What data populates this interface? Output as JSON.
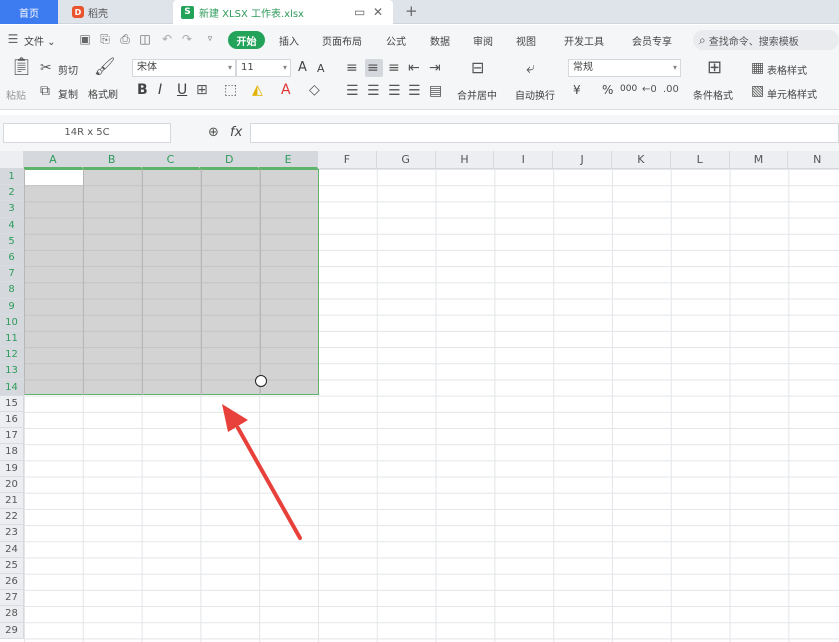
{
  "tabs": {
    "home": "首页",
    "daoke": "稻壳",
    "file": "新建 XLSX 工作表.xlsx",
    "new_tab": "+",
    "close": "✕"
  },
  "menu": {
    "file": "文件",
    "start": "开始",
    "items": [
      "插入",
      "页面布局",
      "公式",
      "数据",
      "审阅",
      "视图",
      "开发工具",
      "会员专享"
    ],
    "search_placeholder": "查找命令、搜索模板"
  },
  "ribbon": {
    "paste": "粘贴",
    "cut": "剪切",
    "copy": "复制",
    "format_painter": "格式刷",
    "font_name": "宋体",
    "font_size": "11",
    "bold": "B",
    "italic": "I",
    "underline": "U",
    "merge_center": "合并居中",
    "wrap_text": "自动换行",
    "number_format": "常规",
    "currency": "¥",
    "percent": "%",
    "thousands": "000",
    "cond_format": "条件格式",
    "table_style": "表格样式",
    "cell_style": "单元格样式",
    "font_grow": "A",
    "font_shrink": "A"
  },
  "formula_bar": {
    "name_box": "14R x 5C",
    "fx": "fx"
  },
  "grid": {
    "columns": [
      "A",
      "B",
      "C",
      "D",
      "E",
      "F",
      "G",
      "H",
      "I",
      "J",
      "K",
      "L",
      "M",
      "N"
    ],
    "rows": [
      "1",
      "2",
      "3",
      "4",
      "5",
      "6",
      "7",
      "8",
      "9",
      "10",
      "11",
      "12",
      "13",
      "14",
      "15",
      "16",
      "17",
      "18",
      "19",
      "20",
      "21",
      "22",
      "23",
      "24",
      "25",
      "26",
      "27",
      "28",
      "29"
    ],
    "selected_columns": 5,
    "selected_rows": 14
  },
  "colors": {
    "accent_green": "#23a35a",
    "tab_blue": "#3d7bf0",
    "arrow_red": "#e8403a"
  }
}
